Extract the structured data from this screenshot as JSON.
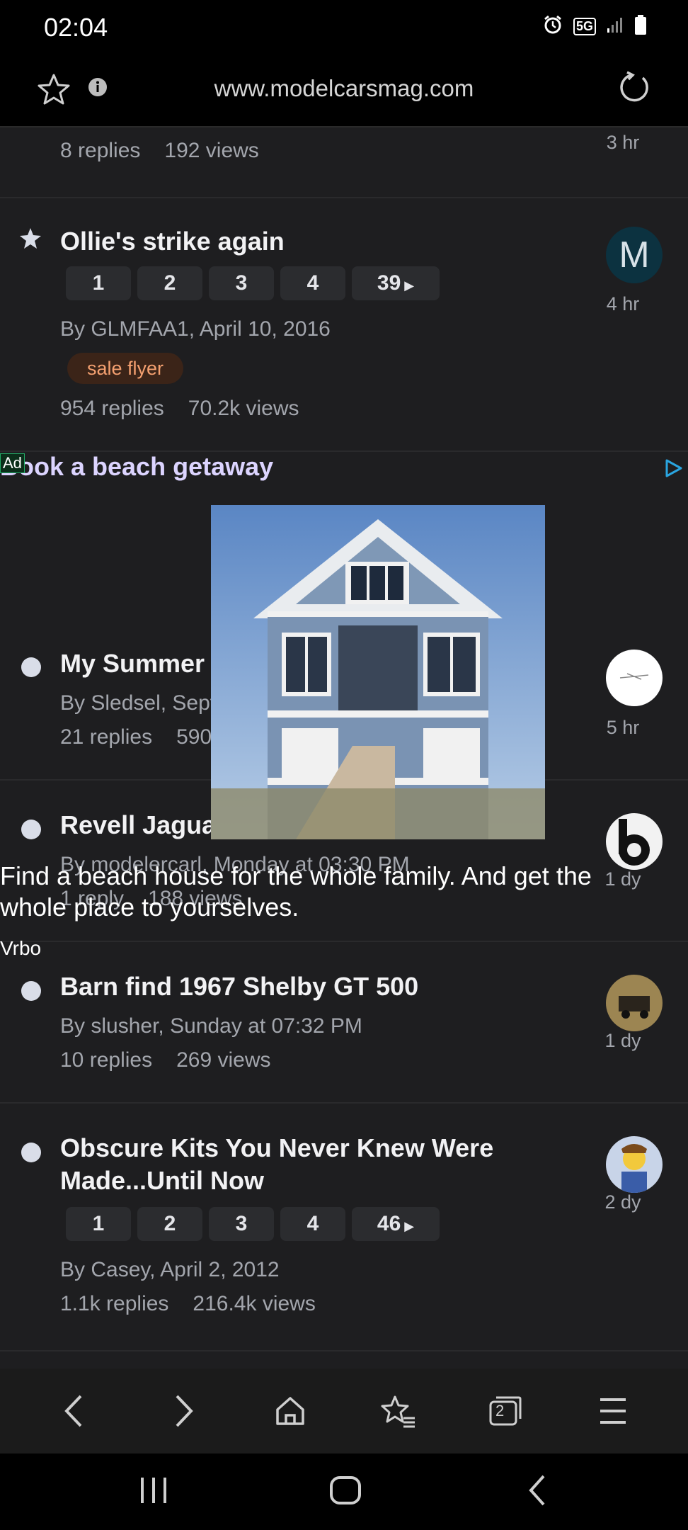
{
  "status_bar": {
    "time": "02:04",
    "network": "5G"
  },
  "browser": {
    "url": "www.modelcarsmag.com"
  },
  "topics_top": {
    "partial": {
      "replies": "8 replies",
      "views": "192 views",
      "age": "3 hr"
    }
  },
  "topics": [
    {
      "title": "Ollie's strike again",
      "pages": [
        "1",
        "2",
        "3",
        "4",
        "39"
      ],
      "byline": "By GLMFAA1, April 10, 2016",
      "tag": "sale flyer",
      "replies": "954 replies",
      "views": "70.2k views",
      "age": "4 hr",
      "avatar_letter": "M"
    },
    {
      "title": "My Summer driver.... finally",
      "byline": "By Sledsel, September 13",
      "replies": "21 replies",
      "views": "590 views",
      "age": "5 hr"
    },
    {
      "title": "Revell Jaguar Roadster",
      "byline": "By modelercarl, Monday at 03:30 PM",
      "replies": "1 reply",
      "views": "188 views",
      "age": "1 dy"
    },
    {
      "title": "Barn find 1967 Shelby GT 500",
      "byline": "By slusher, Sunday at 07:32 PM",
      "replies": "10 replies",
      "views": "269 views",
      "age": "1 dy"
    },
    {
      "title": "Obscure Kits You Never Knew Were Made...Until Now",
      "pages": [
        "1",
        "2",
        "3",
        "4",
        "46"
      ],
      "byline": "By Casey, April 2, 2012",
      "replies": "1.1k replies",
      "views": "216.4k views",
      "age": "2 dy"
    }
  ],
  "ad": {
    "label": "Ad",
    "title": "Book a beach getaway",
    "description": "Find a beach house for the whole family. And get the whole place to yourselves.",
    "brand": "Vrbo"
  },
  "colors": {
    "background": "#1e1e20",
    "accent_tag": "#f4a070",
    "unread_dot": "#d9dde8"
  },
  "icons": {
    "toolbar": [
      "back-icon",
      "forward-icon",
      "home-icon",
      "bookmarks-icon",
      "tabs-icon",
      "menu-icon"
    ],
    "tabs_count": "2"
  }
}
